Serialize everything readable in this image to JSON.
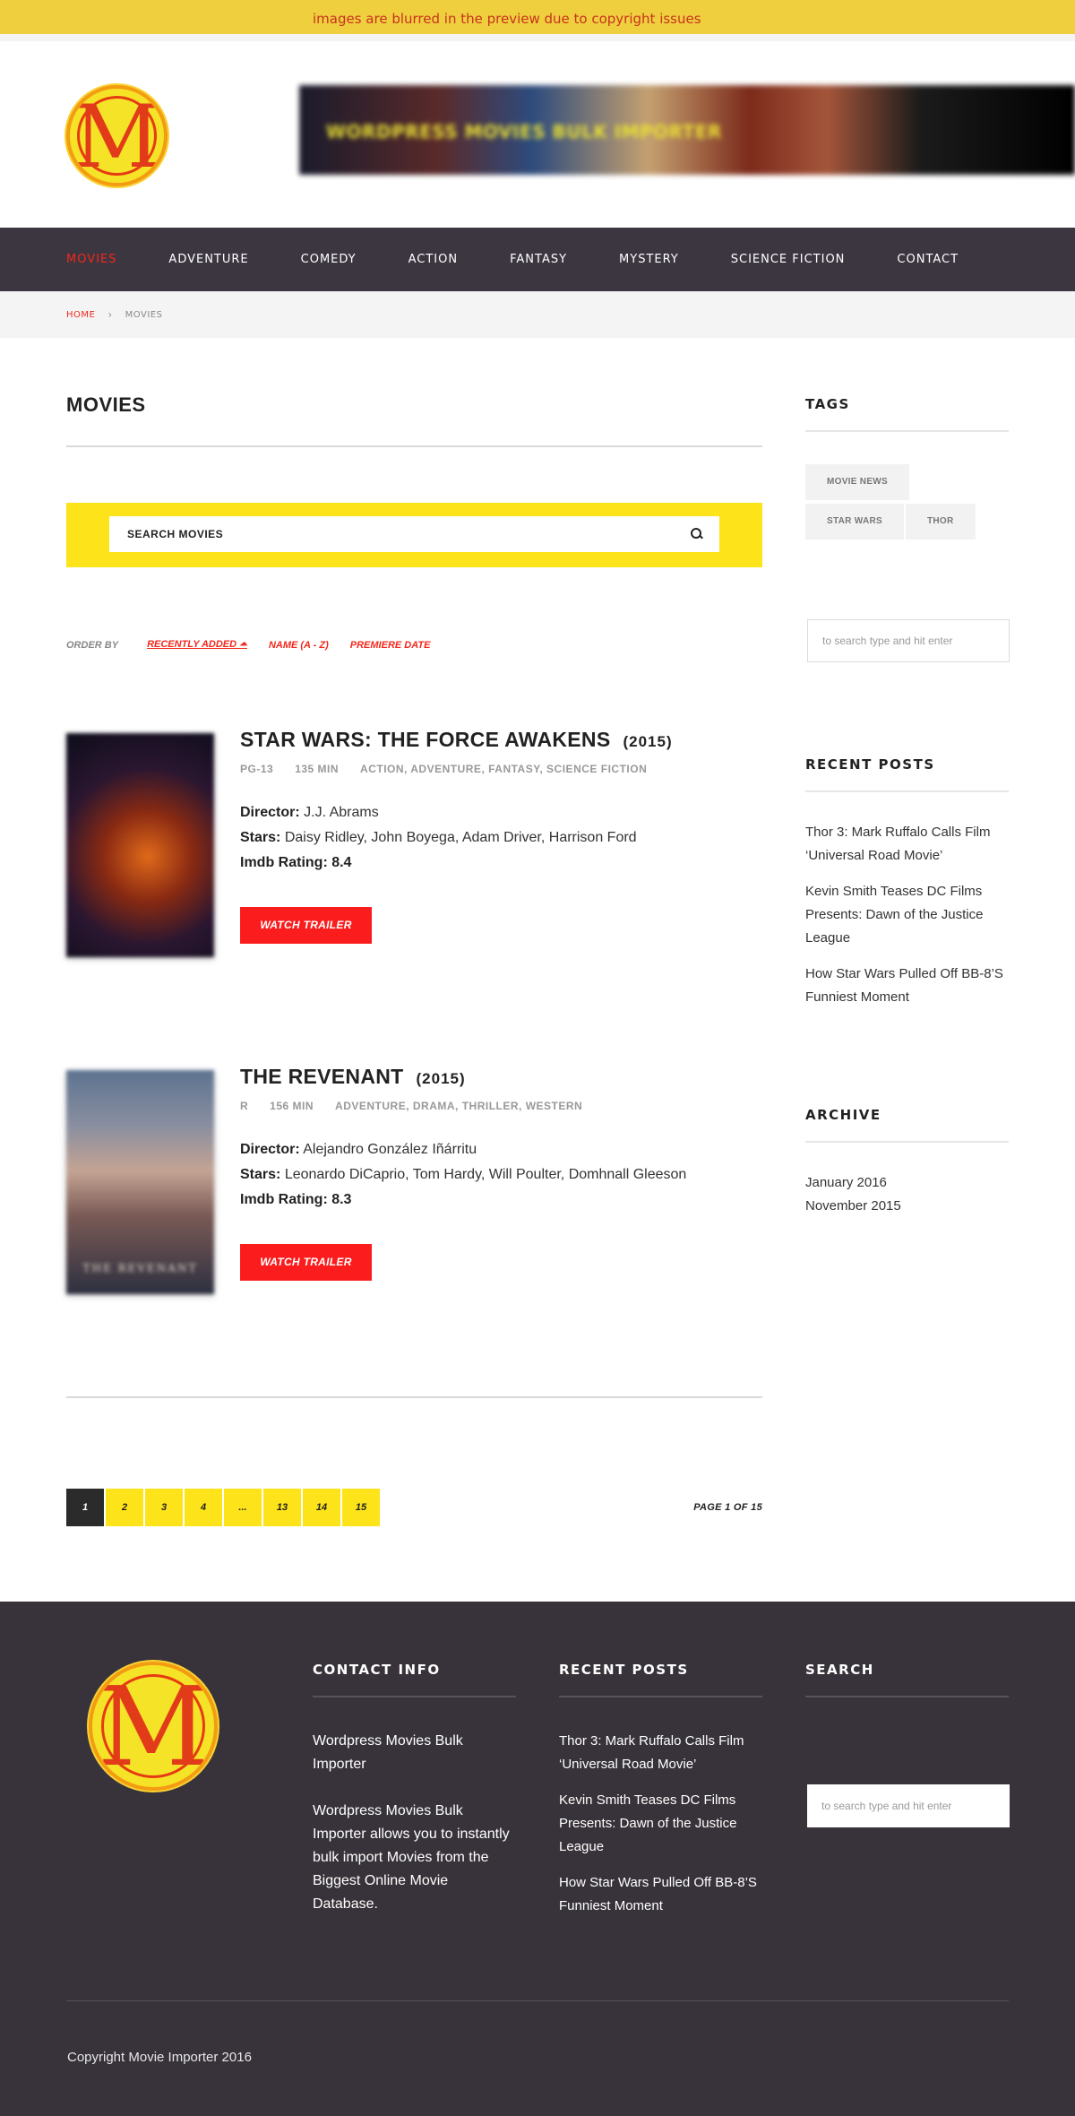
{
  "notice": "images are blurred in the preview due to copyright issues",
  "header": {
    "logo_letter": "M",
    "banner_text": "WORDPRESS MOVIES BULK IMPORTER"
  },
  "nav": {
    "items": [
      "MOVIES",
      "ADVENTURE",
      "COMEDY",
      "ACTION",
      "FANTASY",
      "MYSTERY",
      "SCIENCE FICTION",
      "CONTACT"
    ],
    "active": "MOVIES"
  },
  "breadcrumb": {
    "home": "HOME",
    "separator": "›",
    "current": "MOVIES"
  },
  "main": {
    "title": "MOVIES",
    "search_placeholder": "SEARCH MOVIES",
    "order": {
      "label": "ORDER BY",
      "options": [
        "RECENTLY ADDED ⏶",
        "NAME (A - Z)",
        "PREMIERE DATE"
      ]
    },
    "movies": [
      {
        "title": "STAR WARS: THE FORCE AWAKENS",
        "year": "(2015)",
        "rating": "PG-13",
        "runtime": "135 MIN",
        "genres": "ACTION, ADVENTURE, FANTASY, SCIENCE FICTION",
        "director_label": "Director:",
        "director": "J.J. Abrams",
        "stars_label": "Stars:",
        "stars": "Daisy Ridley, John Boyega, Adam Driver, Harrison Ford",
        "imdb_label": "Imdb Rating",
        "imdb": ": 8.4",
        "trailer": "WATCH TRAILER"
      },
      {
        "title": "THE REVENANT",
        "year": "(2015)",
        "rating": "R",
        "runtime": "156 MIN",
        "genres": "ADVENTURE, DRAMA, THRILLER, WESTERN",
        "director_label": "Director:",
        "director": "Alejandro González Iñárritu",
        "stars_label": "Stars:",
        "stars": "Leonardo DiCaprio, Tom Hardy, Will Poulter, Domhnall Gleeson",
        "imdb_label": "Imdb Rating",
        "imdb": ": 8.3",
        "trailer": "WATCH TRAILER",
        "poster_text": "THE REVENANT"
      }
    ],
    "pagination": {
      "pages": [
        "1",
        "2",
        "3",
        "4",
        "...",
        "13",
        "14",
        "15"
      ],
      "current": "1",
      "summary": "PAGE 1 OF 15"
    }
  },
  "sidebar": {
    "tags_title": "TAGS",
    "tags": [
      "MOVIE NEWS",
      "STAR WARS",
      "THOR"
    ],
    "search_placeholder": "to search type and hit enter",
    "recent_title": "RECENT POSTS",
    "recent_posts": [
      "Thor 3: Mark Ruffalo Calls Film ‘Universal Road Movie’",
      "Kevin Smith Teases DC Films Presents: Dawn of the Justice League",
      "How Star Wars Pulled Off BB-8’S Funniest Moment"
    ],
    "archive_title": "ARCHIVE",
    "archive": [
      "January 2016",
      "November 2015"
    ]
  },
  "footer": {
    "contact_title": "CONTACT INFO",
    "contact_name": "Wordpress Movies Bulk Importer",
    "contact_desc": "Wordpress Movies Bulk Importer allows you to instantly bulk import Movies from the Biggest Online Movie Database.",
    "recent_title": "RECENT POSTS",
    "recent_posts": [
      "Thor 3: Mark Ruffalo Calls Film ‘Universal Road Movie’",
      "Kevin Smith Teases DC Films Presents: Dawn of the Justice League",
      "How Star Wars Pulled Off BB-8’S Funniest Moment"
    ],
    "search_title": "SEARCH",
    "search_placeholder": "to search type and hit enter",
    "copyright": "Copyright Movie Importer 2016"
  },
  "colors": {
    "accent_red": "#f2281c",
    "yellow": "#fde319",
    "nav_bg": "#3c3641",
    "footer_bg": "#38333a"
  }
}
